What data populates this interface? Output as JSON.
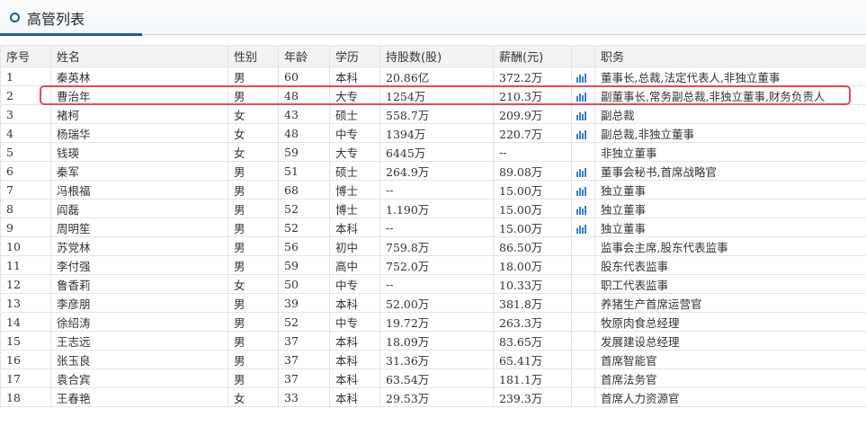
{
  "header": {
    "title": "高管列表"
  },
  "columns": [
    "序号",
    "姓名",
    "性别",
    "年龄",
    "学历",
    "持股数(股)",
    "薪酬(元)",
    "",
    "职务"
  ],
  "rows": [
    {
      "no": "1",
      "name": "秦英林",
      "gender": "男",
      "age": "60",
      "edu": "本科",
      "shares": "20.86亿",
      "salary": "372.2万",
      "chart": true,
      "title": "董事长,总裁,法定代表人,非独立董事"
    },
    {
      "no": "2",
      "name": "曹治年",
      "gender": "男",
      "age": "48",
      "edu": "大专",
      "shares": "1254万",
      "salary": "210.3万",
      "chart": true,
      "title": "副董事长,常务副总裁,非独立董事,财务负责人"
    },
    {
      "no": "3",
      "name": "褚柯",
      "gender": "女",
      "age": "43",
      "edu": "硕士",
      "shares": "558.7万",
      "salary": "209.9万",
      "chart": true,
      "title": "副总裁"
    },
    {
      "no": "4",
      "name": "杨瑞华",
      "gender": "女",
      "age": "48",
      "edu": "中专",
      "shares": "1394万",
      "salary": "220.7万",
      "chart": true,
      "title": "副总裁,非独立董事"
    },
    {
      "no": "5",
      "name": "钱瑛",
      "gender": "女",
      "age": "59",
      "edu": "大专",
      "shares": "6445万",
      "salary": "--",
      "chart": false,
      "title": "非独立董事"
    },
    {
      "no": "6",
      "name": "秦军",
      "gender": "男",
      "age": "51",
      "edu": "硕士",
      "shares": "264.9万",
      "salary": "89.08万",
      "chart": true,
      "title": "董事会秘书,首席战略官"
    },
    {
      "no": "7",
      "name": "冯根福",
      "gender": "男",
      "age": "68",
      "edu": "博士",
      "shares": "--",
      "salary": "15.00万",
      "chart": true,
      "title": "独立董事"
    },
    {
      "no": "8",
      "name": "阎磊",
      "gender": "男",
      "age": "52",
      "edu": "博士",
      "shares": "1.190万",
      "salary": "15.00万",
      "chart": true,
      "title": "独立董事"
    },
    {
      "no": "9",
      "name": "周明笙",
      "gender": "男",
      "age": "52",
      "edu": "本科",
      "shares": "--",
      "salary": "15.00万",
      "chart": true,
      "title": "独立董事"
    },
    {
      "no": "10",
      "name": "苏党林",
      "gender": "男",
      "age": "56",
      "edu": "初中",
      "shares": "759.8万",
      "salary": "86.50万",
      "chart": false,
      "title": "监事会主席,股东代表监事"
    },
    {
      "no": "11",
      "name": "李付强",
      "gender": "男",
      "age": "59",
      "edu": "高中",
      "shares": "752.0万",
      "salary": "18.00万",
      "chart": false,
      "title": "股东代表监事"
    },
    {
      "no": "12",
      "name": "鲁香莉",
      "gender": "女",
      "age": "50",
      "edu": "中专",
      "shares": "--",
      "salary": "10.33万",
      "chart": false,
      "title": "职工代表监事"
    },
    {
      "no": "13",
      "name": "李彦朋",
      "gender": "男",
      "age": "39",
      "edu": "本科",
      "shares": "52.00万",
      "salary": "381.8万",
      "chart": false,
      "title": "养猪生产首席运营官"
    },
    {
      "no": "14",
      "name": "徐绍涛",
      "gender": "男",
      "age": "52",
      "edu": "中专",
      "shares": "19.72万",
      "salary": "263.3万",
      "chart": false,
      "title": "牧原肉食总经理"
    },
    {
      "no": "15",
      "name": "王志远",
      "gender": "男",
      "age": "37",
      "edu": "本科",
      "shares": "18.09万",
      "salary": "83.65万",
      "chart": false,
      "title": "发展建设总经理"
    },
    {
      "no": "16",
      "name": "张玉良",
      "gender": "男",
      "age": "37",
      "edu": "本科",
      "shares": "31.36万",
      "salary": "65.41万",
      "chart": false,
      "title": "首席智能官"
    },
    {
      "no": "17",
      "name": "袁合宾",
      "gender": "男",
      "age": "37",
      "edu": "本科",
      "shares": "63.54万",
      "salary": "181.1万",
      "chart": false,
      "title": "首席法务官"
    },
    {
      "no": "18",
      "name": "王春艳",
      "gender": "女",
      "age": "33",
      "edu": "本科",
      "shares": "29.53万",
      "salary": "239.3万",
      "chart": false,
      "title": "首席人力资源官"
    }
  ],
  "highlight_row": "2",
  "colors": {
    "accent": "#1f5c99",
    "highlight": "#e14a5e",
    "icon": "#3a7bd5"
  }
}
